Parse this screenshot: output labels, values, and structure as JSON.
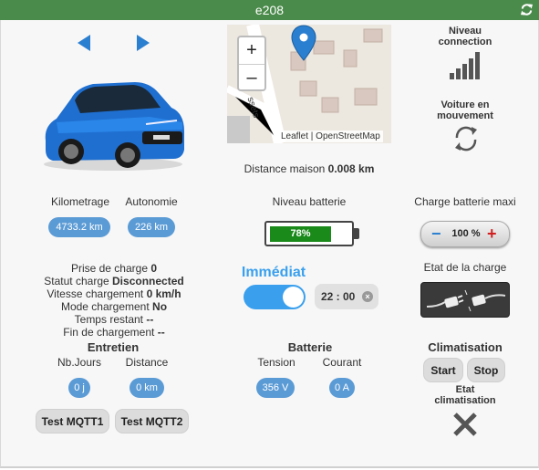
{
  "window": {
    "title": "e208"
  },
  "map": {
    "zoom_in": "+",
    "zoom_out": "–",
    "street_label": "ssets",
    "attribution": "Leaflet | OpenStreetMap"
  },
  "distance": {
    "label": "Distance maison",
    "value": "0.008 km"
  },
  "connection": {
    "label": "Niveau connection",
    "icon": "signal-bars-icon"
  },
  "movement": {
    "label": "Voiture en mouvement",
    "icon": "sync-icon"
  },
  "odometer": {
    "label": "Kilometrage",
    "value": "4733.2 km"
  },
  "range": {
    "label": "Autonomie",
    "value": "226 km"
  },
  "battery": {
    "label": "Niveau batterie",
    "value": "78%",
    "level": 0.78,
    "fill_color": "#1a8a1a"
  },
  "max_charge": {
    "label": "Charge batterie maxi",
    "value": "100 %",
    "minus": "−",
    "plus": "+"
  },
  "charge_info": {
    "prise_label": "Prise de charge",
    "prise_value": "0",
    "status_label": "Statut charge",
    "status_value": "Disconnected",
    "speed_label": "Vitesse chargement",
    "speed_value": "0 km/h",
    "mode_label": "Mode chargement",
    "mode_value": "No",
    "remaining_label": "Temps restant",
    "remaining_value": "--",
    "end_label": "Fin de chargement",
    "end_value": "--"
  },
  "schedule": {
    "mode_label": "Immédiat",
    "toggle_on": true,
    "time": "22 : 00",
    "clear": "×"
  },
  "charge_state": {
    "label": "Etat de la charge",
    "icon": "unplugged-cable-icon"
  },
  "entretien": {
    "title": "Entretien",
    "days_label": "Nb.Jours",
    "days_value": "0 j",
    "distance_label": "Distance",
    "distance_value": "0 km",
    "test1": "Test MQTT1",
    "test2": "Test MQTT2"
  },
  "batterie": {
    "title": "Batterie",
    "tension_label": "Tension",
    "tension_value": "356 V",
    "courant_label": "Courant",
    "courant_value": "0 A"
  },
  "climatisation": {
    "title": "Climatisation",
    "start": "Start",
    "stop": "Stop",
    "state_label": "Etat climatisation",
    "state_icon": "x-icon"
  },
  "colors": {
    "titlebar": "#4a8a4a",
    "accent": "#3aa0ee",
    "pill": "#5b9bd5",
    "car": "#1f6fd0"
  }
}
